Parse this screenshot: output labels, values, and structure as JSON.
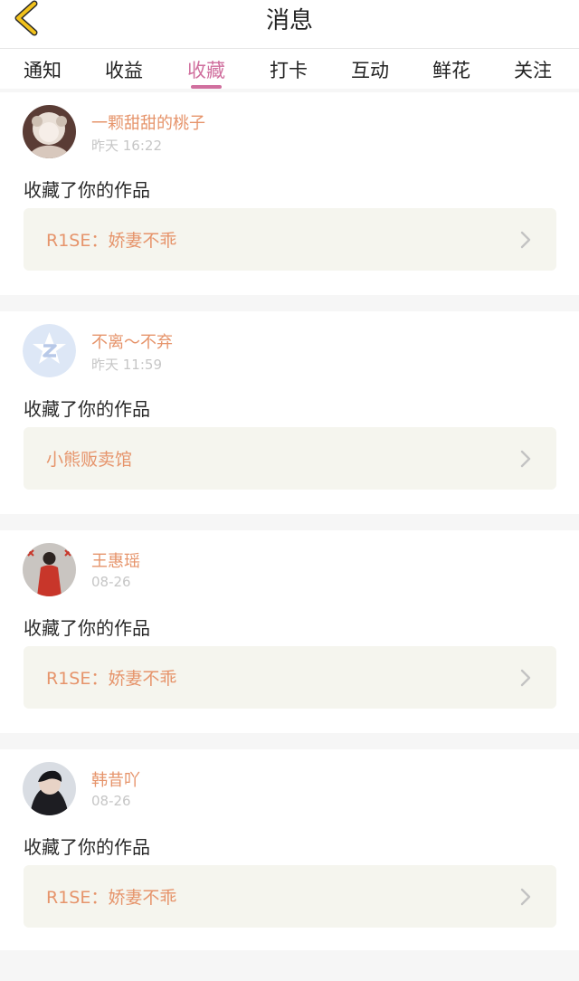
{
  "header": {
    "title": "消息",
    "back_icon": "chevron-left-icon",
    "accent": "#f2c21b"
  },
  "tabs": [
    {
      "label": "通知"
    },
    {
      "label": "收益"
    },
    {
      "label": "收藏",
      "active": true
    },
    {
      "label": "打卡"
    },
    {
      "label": "互动"
    },
    {
      "label": "鲜花"
    },
    {
      "label": "关注"
    }
  ],
  "colors": {
    "accent_pink": "#d06f9e",
    "name_orange": "#e6946b",
    "card_bg": "#ffffff",
    "link_bg": "#f5f5ee"
  },
  "messages": [
    {
      "username": "一颗甜甜的桃子",
      "time": "昨天 16:22",
      "action": "收藏了你的作品",
      "work_title": "R1SE：娇妻不乖",
      "avatar_icon": "user-avatar"
    },
    {
      "username": "不离～不弃",
      "time": "昨天 11:59",
      "action": "收藏了你的作品",
      "work_title": "小熊贩卖馆",
      "avatar_icon": "qq-avatar-icon"
    },
    {
      "username": "王惠瑶",
      "time": "08-26",
      "action": "收藏了你的作品",
      "work_title": "R1SE：娇妻不乖",
      "avatar_icon": "user-avatar"
    },
    {
      "username": "韩昔吖",
      "time": "08-26",
      "action": "收藏了你的作品",
      "work_title": "R1SE：娇妻不乖",
      "avatar_icon": "user-avatar"
    }
  ]
}
